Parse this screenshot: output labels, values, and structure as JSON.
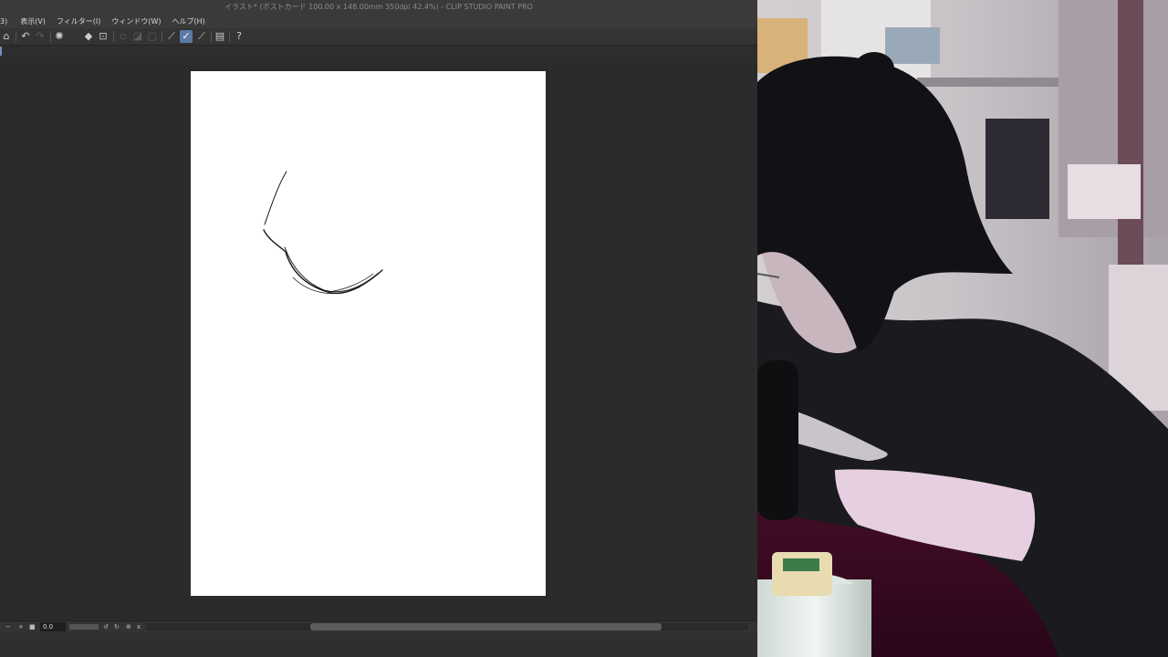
{
  "window": {
    "title": "イラスト* (ポストカード 100.00 x 148.00mm 350dpi 42.4%) - CLIP STUDIO PAINT PRO"
  },
  "menubar": {
    "items": [
      "3)",
      "表示(V)",
      "フィルター(I)",
      "ウィンドウ(W)",
      "ヘルプ(H)"
    ]
  },
  "toolbar": {
    "icons": [
      "quick-access-icon",
      "undo-icon",
      "redo-icon",
      "loading-icon",
      "fill-icon",
      "crop-icon",
      "selection-clear-icon",
      "selection-invert-icon",
      "selection-border-icon",
      "ruler-icon",
      "ruler-snap-icon",
      "ruler-special-icon",
      "layer-settings-icon",
      "help-icon"
    ]
  },
  "statusbar": {
    "zoom_value": "0.0",
    "buttons": [
      "−",
      "+",
      "■",
      "↺",
      "↻",
      "⊕",
      "x"
    ]
  },
  "colors": {
    "app_background": "#2b2b2b",
    "menubar": "#3a3a3a",
    "paper": "#ffffff",
    "accent": "#5b7aa6"
  }
}
